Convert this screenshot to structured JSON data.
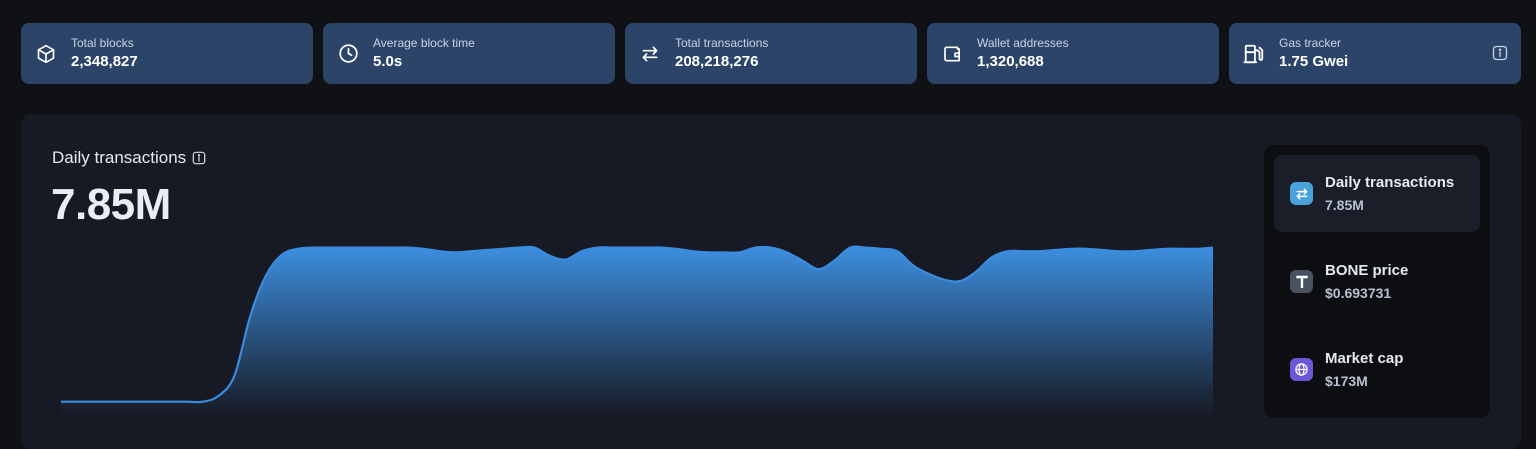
{
  "stats": [
    {
      "label": "Total blocks",
      "value": "2,348,827",
      "icon": "cube-icon"
    },
    {
      "label": "Average block time",
      "value": "5.0s",
      "icon": "clock-icon"
    },
    {
      "label": "Total transactions",
      "value": "208,218,276",
      "icon": "transfer-arrows-icon"
    },
    {
      "label": "Wallet addresses",
      "value": "1,320,688",
      "icon": "wallet-icon"
    },
    {
      "label": "Gas tracker",
      "value": "1.75 Gwei",
      "icon": "gas-pump-icon"
    }
  ],
  "chart_panel": {
    "title": "Daily transactions",
    "value": "7.85M"
  },
  "chart_data": {
    "type": "area",
    "title": "",
    "xlabel": "",
    "ylabel": "",
    "grid": false,
    "series": [
      {
        "values": [
          0.12,
          0.12,
          0.12,
          0.12,
          0.12,
          0.12,
          0.12,
          0.12,
          0.12,
          0.12,
          0.17,
          0.34,
          0.84,
          1.18,
          1.35,
          1.4,
          1.41,
          1.41,
          1.41,
          1.41,
          1.41,
          1.41,
          1.41,
          1.4,
          1.38,
          1.37,
          1.38,
          1.39,
          1.4,
          1.41,
          1.41,
          1.34,
          1.31,
          1.38,
          1.41,
          1.41,
          1.41,
          1.41,
          1.41,
          1.4,
          1.38,
          1.37,
          1.37,
          1.37,
          1.41,
          1.41,
          1.37,
          1.3,
          1.23,
          1.3,
          1.41,
          1.41,
          1.4,
          1.38,
          1.26,
          1.19,
          1.14,
          1.13,
          1.21,
          1.33,
          1.38,
          1.38,
          1.38,
          1.39,
          1.4,
          1.4,
          1.39,
          1.38,
          1.38,
          1.39,
          1.4,
          1.4,
          1.4,
          1.41
        ]
      }
    ],
    "colors": {
      "line": "#3a8ce0",
      "fill_top": "#3d8fe0",
      "fill_bottom": "#171a24"
    }
  },
  "side_panel": {
    "items": [
      {
        "label": "Daily transactions",
        "value": "7.85M",
        "icon": "transfer-arrows-icon",
        "color": "#4aa3d8",
        "active": true
      },
      {
        "label": "BONE price",
        "value": "$0.693731",
        "icon": "token-t-icon",
        "color": "#4a5262",
        "active": false
      },
      {
        "label": "Market cap",
        "value": "$173M",
        "icon": "globe-icon",
        "color": "#6a57d8",
        "active": false
      }
    ]
  }
}
